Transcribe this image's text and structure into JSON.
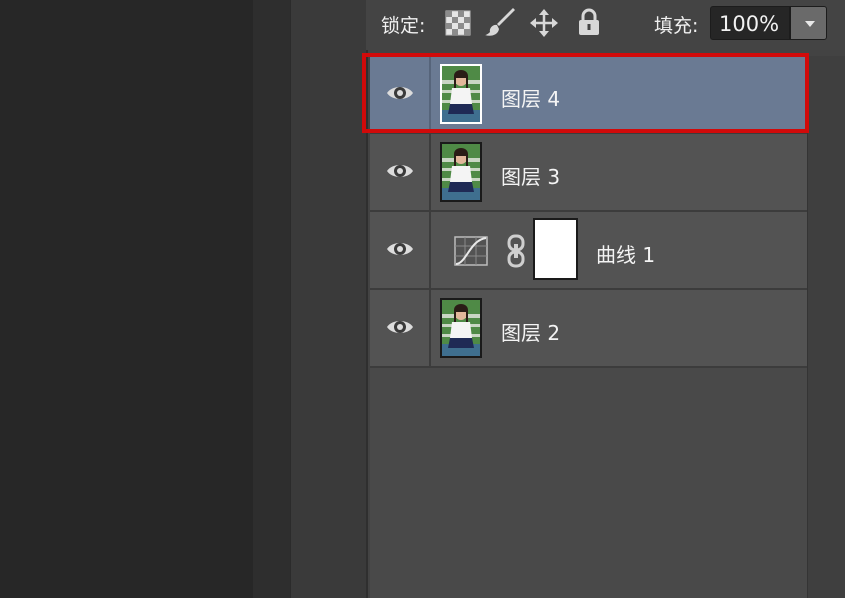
{
  "panel": {
    "lock_label": "锁定:",
    "lock_icons": [
      "transparency-lock-icon",
      "brush-icon",
      "move-icon",
      "padlock-icon"
    ],
    "fill_label": "填充:",
    "fill_value": "100%"
  },
  "layers": [
    {
      "label": "图层 4",
      "selected": true,
      "thumb": "photo"
    },
    {
      "label": "图层 3",
      "selected": false,
      "thumb": "photo"
    },
    {
      "label": "曲线 1",
      "selected": false,
      "thumb": "curves-adjustment",
      "mask": true
    },
    {
      "label": "图层 2",
      "selected": false,
      "thumb": "photo"
    }
  ],
  "colors": {
    "selected_row": "#6a7a93",
    "highlight_box": "#d10a0a"
  }
}
